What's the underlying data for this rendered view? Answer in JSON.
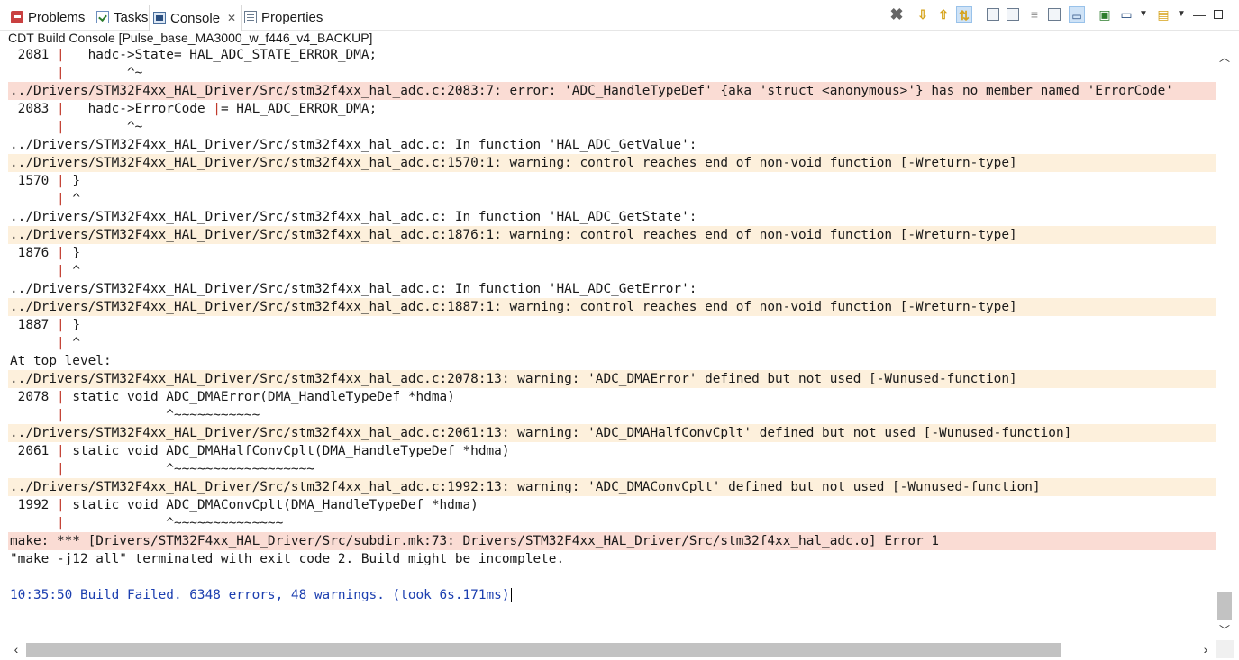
{
  "tabs": {
    "problems": "Problems",
    "tasks": "Tasks",
    "console": "Console",
    "console_close": "✕",
    "properties": "Properties"
  },
  "console_title": "CDT Build Console [Pulse_base_MA3000_w_f446_v4_BACKUP]",
  "colors": {
    "error_bg": "#fadcd4",
    "warning_bg": "#fdf0dc",
    "info_text": "#1c3fb0",
    "gutter_bar": "#c0392b"
  },
  "console_lines": [
    {
      "type": "code",
      "gutter": " 2081 ",
      "bar": "|",
      "text": "   hadc->State= HAL_ADC_STATE_ERROR_DMA;"
    },
    {
      "type": "code",
      "gutter": "      ",
      "bar": "|",
      "text": "        ^~"
    },
    {
      "type": "error",
      "text": "../Drivers/STM32F4xx_HAL_Driver/Src/stm32f4xx_hal_adc.c:2083:7: error: 'ADC_HandleTypeDef' {aka 'struct <anonymous>'} has no member named 'ErrorCode'"
    },
    {
      "type": "code",
      "gutter": " 2083 ",
      "bar": "|",
      "text": "   hadc->ErrorCode ",
      "tail": "|",
      "text2": "= HAL_ADC_ERROR_DMA;"
    },
    {
      "type": "code",
      "gutter": "      ",
      "bar": "|",
      "text": "        ^~"
    },
    {
      "type": "plain",
      "text": "../Drivers/STM32F4xx_HAL_Driver/Src/stm32f4xx_hal_adc.c: In function 'HAL_ADC_GetValue':"
    },
    {
      "type": "warning",
      "text": "../Drivers/STM32F4xx_HAL_Driver/Src/stm32f4xx_hal_adc.c:1570:1: warning: control reaches end of non-void function [-Wreturn-type]"
    },
    {
      "type": "code",
      "gutter": " 1570 ",
      "bar": "|",
      "text": " }"
    },
    {
      "type": "code",
      "gutter": "      ",
      "bar": "|",
      "text": " ^"
    },
    {
      "type": "plain",
      "text": "../Drivers/STM32F4xx_HAL_Driver/Src/stm32f4xx_hal_adc.c: In function 'HAL_ADC_GetState':"
    },
    {
      "type": "warning",
      "text": "../Drivers/STM32F4xx_HAL_Driver/Src/stm32f4xx_hal_adc.c:1876:1: warning: control reaches end of non-void function [-Wreturn-type]"
    },
    {
      "type": "code",
      "gutter": " 1876 ",
      "bar": "|",
      "text": " }"
    },
    {
      "type": "code",
      "gutter": "      ",
      "bar": "|",
      "text": " ^"
    },
    {
      "type": "plain",
      "text": "../Drivers/STM32F4xx_HAL_Driver/Src/stm32f4xx_hal_adc.c: In function 'HAL_ADC_GetError':"
    },
    {
      "type": "warning",
      "text": "../Drivers/STM32F4xx_HAL_Driver/Src/stm32f4xx_hal_adc.c:1887:1: warning: control reaches end of non-void function [-Wreturn-type]"
    },
    {
      "type": "code",
      "gutter": " 1887 ",
      "bar": "|",
      "text": " }"
    },
    {
      "type": "code",
      "gutter": "      ",
      "bar": "|",
      "text": " ^"
    },
    {
      "type": "plain",
      "text": "At top level:"
    },
    {
      "type": "warning",
      "text": "../Drivers/STM32F4xx_HAL_Driver/Src/stm32f4xx_hal_adc.c:2078:13: warning: 'ADC_DMAError' defined but not used [-Wunused-function]"
    },
    {
      "type": "code",
      "gutter": " 2078 ",
      "bar": "|",
      "text": " static void ADC_DMAError(DMA_HandleTypeDef *hdma)"
    },
    {
      "type": "code",
      "gutter": "      ",
      "bar": "|",
      "text": "             ^~~~~~~~~~~~"
    },
    {
      "type": "warning",
      "text": "../Drivers/STM32F4xx_HAL_Driver/Src/stm32f4xx_hal_adc.c:2061:13: warning: 'ADC_DMAHalfConvCplt' defined but not used [-Wunused-function]"
    },
    {
      "type": "code",
      "gutter": " 2061 ",
      "bar": "|",
      "text": " static void ADC_DMAHalfConvCplt(DMA_HandleTypeDef *hdma)"
    },
    {
      "type": "code",
      "gutter": "      ",
      "bar": "|",
      "text": "             ^~~~~~~~~~~~~~~~~~~"
    },
    {
      "type": "warning",
      "text": "../Drivers/STM32F4xx_HAL_Driver/Src/stm32f4xx_hal_adc.c:1992:13: warning: 'ADC_DMAConvCplt' defined but not used [-Wunused-function]"
    },
    {
      "type": "code",
      "gutter": " 1992 ",
      "bar": "|",
      "text": " static void ADC_DMAConvCplt(DMA_HandleTypeDef *hdma)"
    },
    {
      "type": "code",
      "gutter": "      ",
      "bar": "|",
      "text": "             ^~~~~~~~~~~~~~~"
    },
    {
      "type": "error",
      "text": "make: *** [Drivers/STM32F4xx_HAL_Driver/Src/subdir.mk:73: Drivers/STM32F4xx_HAL_Driver/Src/stm32f4xx_hal_adc.o] Error 1"
    },
    {
      "type": "plain",
      "text": "\"make -j12 all\" terminated with exit code 2. Build might be incomplete."
    },
    {
      "type": "blank",
      "text": ""
    },
    {
      "type": "info",
      "text": "10:35:50 Build Failed. 6348 errors, 48 warnings. (took 6s.171ms)",
      "cursor": true
    }
  ],
  "scroll": {
    "vertical_position": 0.97,
    "horizontal_visible_fraction": 0.88
  }
}
